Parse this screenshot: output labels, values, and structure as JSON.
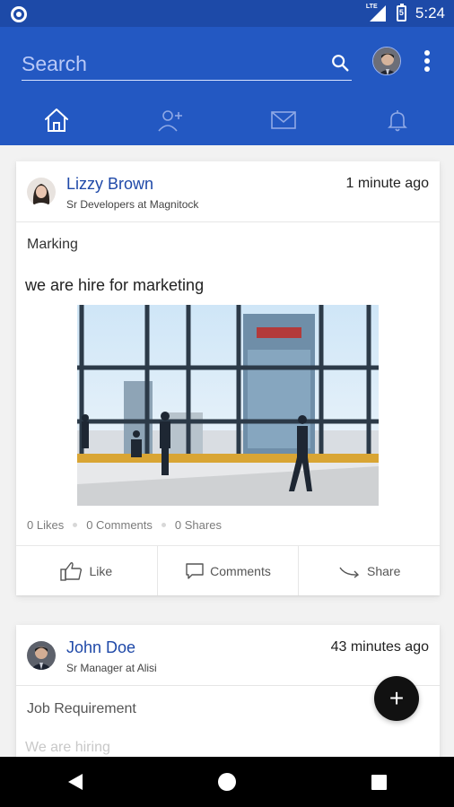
{
  "status_bar": {
    "time": "5:24",
    "network": "LTE",
    "battery_level": "5"
  },
  "app_bar": {
    "search": {
      "placeholder": "Search",
      "value": ""
    },
    "tabs": [
      {
        "id": "home",
        "icon": "home-icon",
        "selected": true
      },
      {
        "id": "add-friend",
        "icon": "person-add-icon",
        "selected": false
      },
      {
        "id": "messages",
        "icon": "mail-icon",
        "selected": false
      },
      {
        "id": "notifications",
        "icon": "bell-icon",
        "selected": false
      }
    ]
  },
  "feed": {
    "posts": [
      {
        "author": "Lizzy Brown",
        "role": "Sr Developers at Magnitock",
        "time": "1 minute ago",
        "category": "Marking",
        "text": "we are hire for marketing",
        "stats": {
          "likes": "0 Likes",
          "comments": "0 Comments",
          "shares": "0 Shares"
        },
        "actions": {
          "like": "Like",
          "comments": "Comments",
          "share": "Share"
        }
      },
      {
        "author": "John Doe",
        "role": "Sr Manager at Alisi",
        "time": "43 minutes ago",
        "category": "Job Requirement",
        "text": "We are hiring"
      }
    ]
  },
  "fab": {
    "symbol": "+"
  },
  "colors": {
    "primary": "#2358c2",
    "status_bar": "#1d4aa8",
    "author_name": "#1f49a8"
  }
}
